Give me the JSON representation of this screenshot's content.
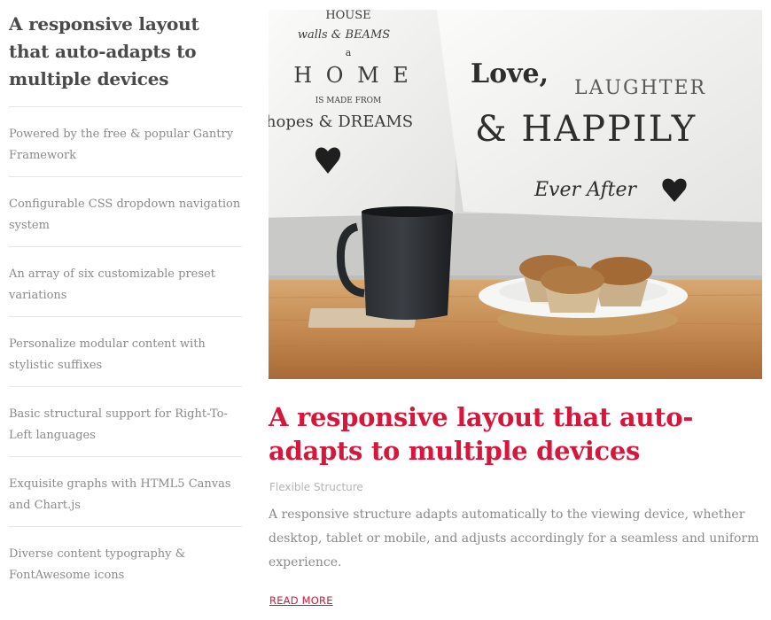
{
  "sidebar": {
    "heading": "A responsive layout that auto-adapts to multiple devices",
    "items": [
      {
        "label": "Powered by the free & popular Gantry Framework"
      },
      {
        "label": "Configurable CSS dropdown navigation system"
      },
      {
        "label": "An array of six customizable preset variations"
      },
      {
        "label": "Personalize modular content with stylistic suffixes"
      },
      {
        "label": "Basic structural support for Right-To-Left languages"
      },
      {
        "label": "Exquisite graphs with HTML5 Canvas and Chart.js"
      },
      {
        "label": "Diverse content typography & FontAwesome icons"
      }
    ]
  },
  "hero": {
    "pillow_left_text": [
      "HOUSE",
      "walls & BEAMS",
      "a",
      "H O M E",
      "IS MADE FROM",
      "hopes & DREAMS"
    ],
    "pillow_right_text": [
      "Love,",
      "LAUGHTER",
      "& HAPPILY",
      "Ever After"
    ]
  },
  "article": {
    "title": "A responsive layout that auto-adapts to multiple devices",
    "category": "Flexible Structure",
    "body": "A responsive structure adapts automatically to the viewing device, whether desktop, tablet or mobile, and adjusts accordingly for a seamless and uniform experience.",
    "read_more": "READ MORE"
  },
  "colors": {
    "accent": "#d6173b",
    "text": "#8a8a8a",
    "heading": "#4a4a4a"
  }
}
